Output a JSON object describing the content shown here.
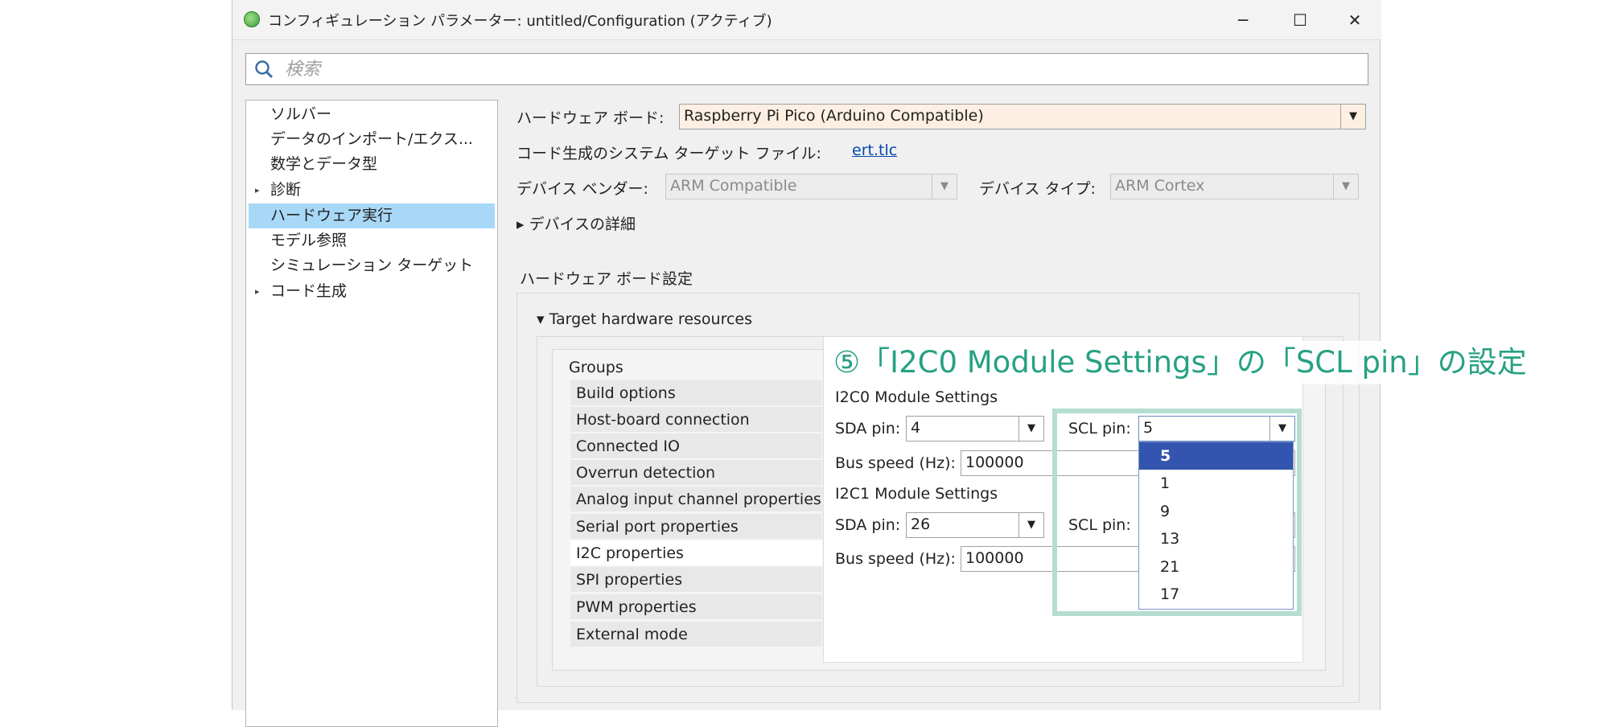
{
  "window": {
    "title": "コンフィギュレーション パラメーター: untitled/Configuration (アクティブ)",
    "minimize": "─",
    "maximize": "☐",
    "close": "✕"
  },
  "search": {
    "placeholder": "検索"
  },
  "tree": {
    "items": [
      {
        "label": "ソルバー"
      },
      {
        "label": "データのインポート/エクス..."
      },
      {
        "label": "数学とデータ型"
      },
      {
        "label": "診断",
        "expander": "▸"
      },
      {
        "label": "ハードウェア実行"
      },
      {
        "label": "モデル参照"
      },
      {
        "label": "シミュレーション ターゲット"
      },
      {
        "label": "コード生成",
        "expander": "▸"
      }
    ]
  },
  "main": {
    "hw_board_label": "ハードウェア ボード:",
    "hw_board_value": "Raspberry Pi Pico (Arduino Compatible)",
    "target_file_label": "コード生成のシステム ターゲット ファイル:",
    "target_file_link": "ert.tlc",
    "device_vendor_label": "デバイス ベンダー:",
    "device_vendor_value": "ARM Compatible",
    "device_type_label": "デバイス タイプ:",
    "device_type_value": "ARM Cortex",
    "device_details": "▸ デバイスの詳細",
    "board_settings_heading": "ハードウェア ボード設定",
    "target_resources": "▾ Target hardware resources",
    "groups_heading": "Groups",
    "groups": [
      "Build options",
      "Host-board connection",
      "Connected IO",
      "Overrun detection",
      "Analog input channel properties",
      "Serial port properties",
      "I2C properties",
      "SPI properties",
      "PWM properties",
      "External mode"
    ],
    "i2c0_heading": "I2C0 Module Settings",
    "i2c1_heading": "I2C1 Module Settings",
    "sda_label": "SDA pin:",
    "scl_label": "SCL pin:",
    "bus_speed_label": "Bus speed (Hz):",
    "i2c0_sda_value": "4",
    "i2c0_scl_value": "5",
    "i2c0_bus_speed": "100000",
    "i2c1_sda_value": "26",
    "i2c1_bus_speed": "100000",
    "scl_options": [
      "5",
      "1",
      "9",
      "13",
      "21",
      "17"
    ]
  },
  "annotation": "⑤「I2C0 Module Settings」の「SCL pin」の設定",
  "colors": {
    "selection": "#a8d8f8",
    "dropdown_selected": "#3355b0",
    "annotation": "#27a183",
    "callout": "#b4ddd0"
  }
}
